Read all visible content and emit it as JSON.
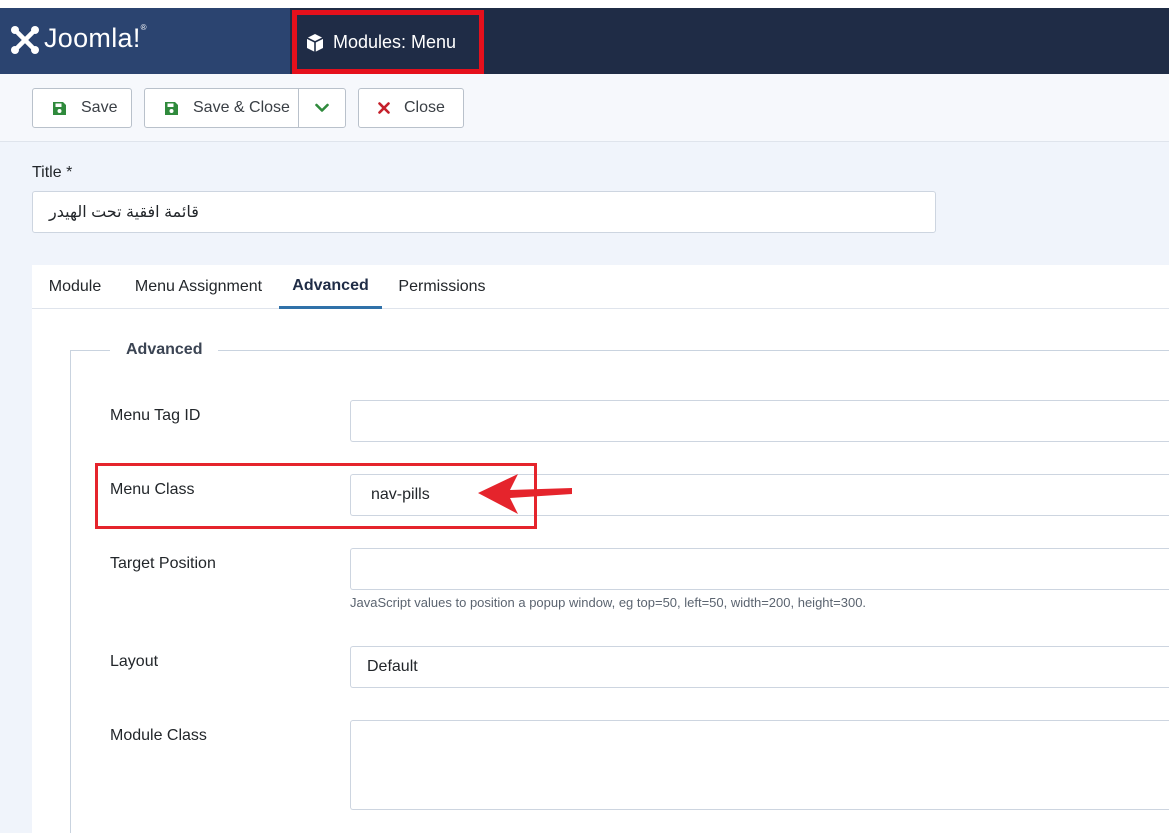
{
  "header": {
    "brand_name": "Joomla!",
    "page_title": "Modules: Menu",
    "page_icon": "cube-icon",
    "colors": {
      "header_bg": "#1f2c46",
      "brand_bg": "#2b4470",
      "highlight": "#e5101c"
    }
  },
  "toolbar": {
    "save_label": "Save",
    "save_close_label": "Save & Close",
    "close_label": "Close"
  },
  "form": {
    "title_label": "Title *",
    "title_value": "قائمة افقية تحت الهيدر"
  },
  "tabs": [
    {
      "label": "Module",
      "active": false
    },
    {
      "label": "Menu Assignment",
      "active": false
    },
    {
      "label": "Advanced",
      "active": true
    },
    {
      "label": "Permissions",
      "active": false
    }
  ],
  "advanced": {
    "legend": "Advanced",
    "menu_tag_id": {
      "label": "Menu Tag ID",
      "value": ""
    },
    "menu_class": {
      "label": "Menu Class",
      "value": "nav-pills"
    },
    "target_position": {
      "label": "Target Position",
      "value": "",
      "help": "JavaScript values to position a popup window, eg top=50, left=50, width=200, height=300."
    },
    "layout": {
      "label": "Layout",
      "value": "Default"
    },
    "module_class": {
      "label": "Module Class",
      "value": ""
    }
  }
}
